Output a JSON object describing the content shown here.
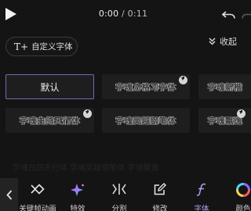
{
  "playback": {
    "current_time": "0:00",
    "separator": "/",
    "total_time": "0:11"
  },
  "custom_font": {
    "icon": "T+",
    "label": "自定义字体"
  },
  "collapse": {
    "label": "收起"
  },
  "fonts": [
    {
      "label": "默认",
      "selected": true
    },
    {
      "label": "字魂方格习字体",
      "download": true
    },
    {
      "label": "字魂新楷",
      "download": false
    },
    {
      "label": "字魂白鸽天行体",
      "download": true
    },
    {
      "label": "字魂吴越钢笔体",
      "download": false
    },
    {
      "label": "字魂飘逸",
      "download": true
    }
  ],
  "footer_faint": "字魂白鸽天行体 字魂吴越钢笔体 字魂飘逸",
  "toolbar": {
    "back_icon": "chevron-left-icon",
    "items": [
      {
        "icon": "keyframe-icon",
        "label": "关键帧动画"
      },
      {
        "icon": "sparkle-icon",
        "label": "特效"
      },
      {
        "icon": "split-icon",
        "label": "分割"
      },
      {
        "icon": "edit-icon",
        "label": "修改"
      },
      {
        "icon": "font-f-icon",
        "label": "字体",
        "active": true
      },
      {
        "icon": "color-wheel-icon",
        "label": "颜色"
      }
    ],
    "active_color": "#a9a6f3"
  },
  "colors": {
    "background": "#141414",
    "tile": "#1e1e1e",
    "selected_border": "#6d6cb4"
  }
}
